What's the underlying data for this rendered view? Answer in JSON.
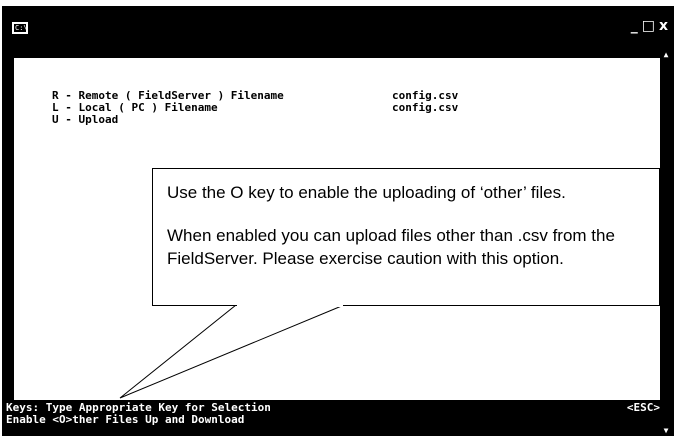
{
  "window": {
    "icon_label": "C:\\",
    "minimize": "_",
    "maximize": "□",
    "close": "x"
  },
  "console": {
    "lines": [
      {
        "label": "R - Remote ( FieldServer ) Filename",
        "value": "config.csv"
      },
      {
        "label": "L - Local ( PC ) Filename",
        "value": "config.csv"
      },
      {
        "label": "U - Upload",
        "value": ""
      }
    ]
  },
  "status": {
    "line1": "Keys: Type Appropriate Key for Selection",
    "esc": "<ESC>",
    "line2": "Enable <O>ther Files Up and Download"
  },
  "callout": {
    "line1": "Use the O key to enable the uploading of ‘other’ files.",
    "line2": "When enabled you can upload files other than .csv from the FieldServer. Please exercise caution with this option."
  },
  "icons": {
    "window_icon": "console-window-icon",
    "scroll_up": "scroll-up-arrow-icon",
    "scroll_down": "scroll-down-arrow-icon"
  },
  "colors": {
    "frame": "#000000",
    "console_bg": "#ffffff",
    "text": "#000000",
    "status_text": "#ffffff"
  }
}
